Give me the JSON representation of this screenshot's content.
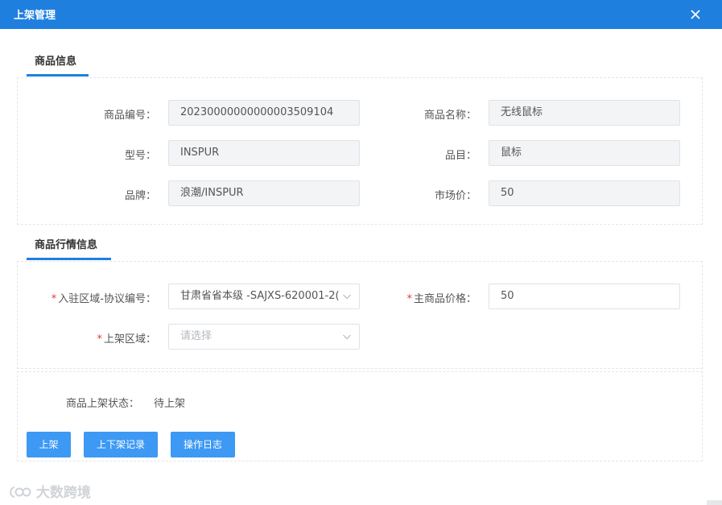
{
  "dialog": {
    "title": "上架管理"
  },
  "sections": {
    "product_info": "商品信息",
    "market_info": "商品行情信息"
  },
  "product": {
    "code_label": "商品编号：",
    "code_value": "20230000000000003509104",
    "name_label": "商品名称：",
    "name_value": "无线鼠标",
    "model_label": "型号：",
    "model_value": "INSPUR",
    "category_label": "品目：",
    "category_value": "鼠标",
    "brand_label": "品牌：",
    "brand_value": "浪潮/INSPUR",
    "price_label": "市场价：",
    "price_value": "50"
  },
  "market": {
    "required_mark": "*",
    "region_label": "入驻区域-协议编号：",
    "region_value": "甘肃省省本级 -SAJXS-620001-2(",
    "main_price_label": "主商品价格：",
    "main_price_value": "50",
    "shelf_region_label": "上架区域：",
    "shelf_region_placeholder": "请选择"
  },
  "status": {
    "label": "商品上架状态：",
    "value": "待上架"
  },
  "buttons": {
    "shelve": "上架",
    "records": "上下架记录",
    "log": "操作日志"
  },
  "watermark": {
    "text": "大数跨境"
  },
  "colors": {
    "header": "#1f7fdf",
    "button": "#3d99f4",
    "required": "#e23b3b"
  }
}
